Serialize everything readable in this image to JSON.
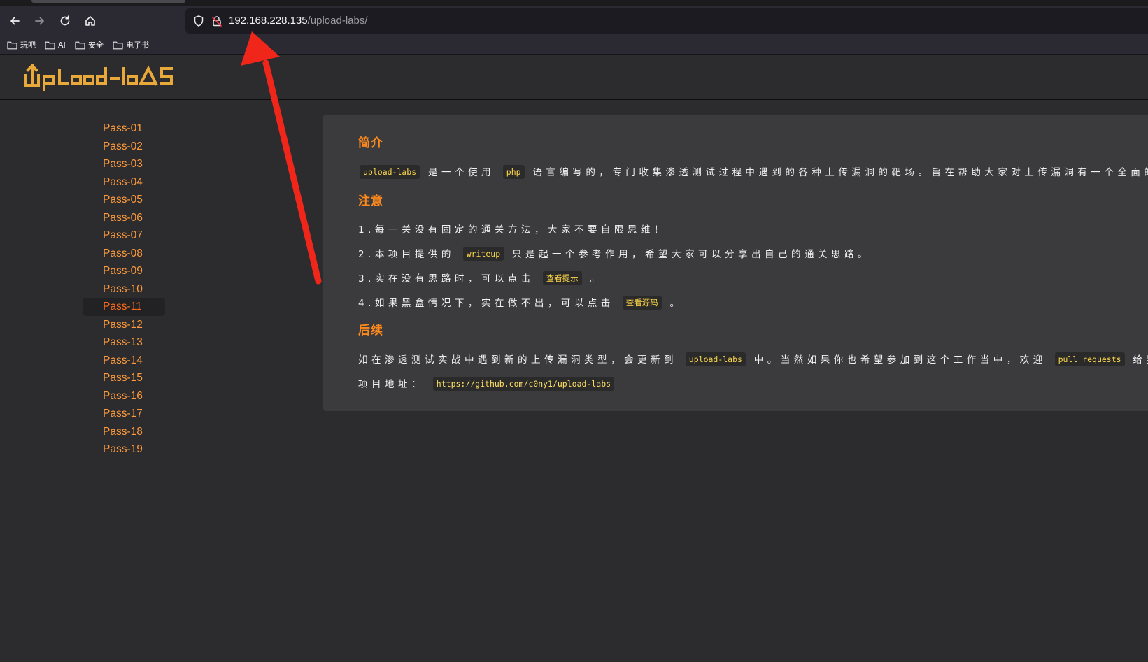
{
  "browser": {
    "url_host": "192.168.228.135",
    "url_path": "/upload-labs/",
    "bookmarks": [
      {
        "label": "玩吧"
      },
      {
        "label": "AI"
      },
      {
        "label": "安全"
      },
      {
        "label": "电子书"
      }
    ]
  },
  "site": {
    "logo_text": "upload-labs",
    "sidebar": {
      "items": [
        {
          "label": "Pass-01"
        },
        {
          "label": "Pass-02"
        },
        {
          "label": "Pass-03"
        },
        {
          "label": "Pass-04"
        },
        {
          "label": "Pass-05"
        },
        {
          "label": "Pass-06"
        },
        {
          "label": "Pass-07"
        },
        {
          "label": "Pass-08"
        },
        {
          "label": "Pass-09"
        },
        {
          "label": "Pass-10"
        },
        {
          "label": "Pass-11"
        },
        {
          "label": "Pass-12"
        },
        {
          "label": "Pass-13"
        },
        {
          "label": "Pass-14"
        },
        {
          "label": "Pass-15"
        },
        {
          "label": "Pass-16"
        },
        {
          "label": "Pass-17"
        },
        {
          "label": "Pass-18"
        },
        {
          "label": "Pass-19"
        }
      ],
      "active_index": 10
    },
    "intro": {
      "title": "简介",
      "code_project": "upload-labs",
      "text_a": "是一个使用",
      "code_lang": "php",
      "text_b": "语言编写的，专门收集渗透测试过程中遇到的各种上传漏洞的靶场。旨在帮助大家对上传漏洞有一个全面的了"
    },
    "notice": {
      "title": "注意",
      "line1": "1.每一关没有固定的通关方法，大家不要自限思维！",
      "line2_a": "2.本项目提供的",
      "line2_code": "writeup",
      "line2_b": "只是起一个参考作用，希望大家可以分享出自己的通关思路。",
      "line3_a": "3.实在没有思路时，可以点击",
      "line3_btn": "查看提示",
      "line3_b": "。",
      "line4_a": "4.如果黑盒情况下，实在做不出，可以点击",
      "line4_btn": "查看源码",
      "line4_b": "。"
    },
    "followup": {
      "title": "后续",
      "line1_a": "如在渗透测试实战中遇到新的上传漏洞类型，会更新到",
      "line1_code": "upload-labs",
      "line1_b": "中。当然如果你也希望参加到这个工作当中，欢迎",
      "line1_code2": "pull requests",
      "line1_c": "给我！",
      "line2_label": "项目地址：",
      "line2_link": "https://github.com/c0ny1/upload-labs"
    }
  },
  "colors": {
    "accent_orange": "#ff9a3c",
    "active_orange": "#ff6a1a",
    "code_yellow": "#ffd84a",
    "annotation_red": "#f0261b"
  }
}
